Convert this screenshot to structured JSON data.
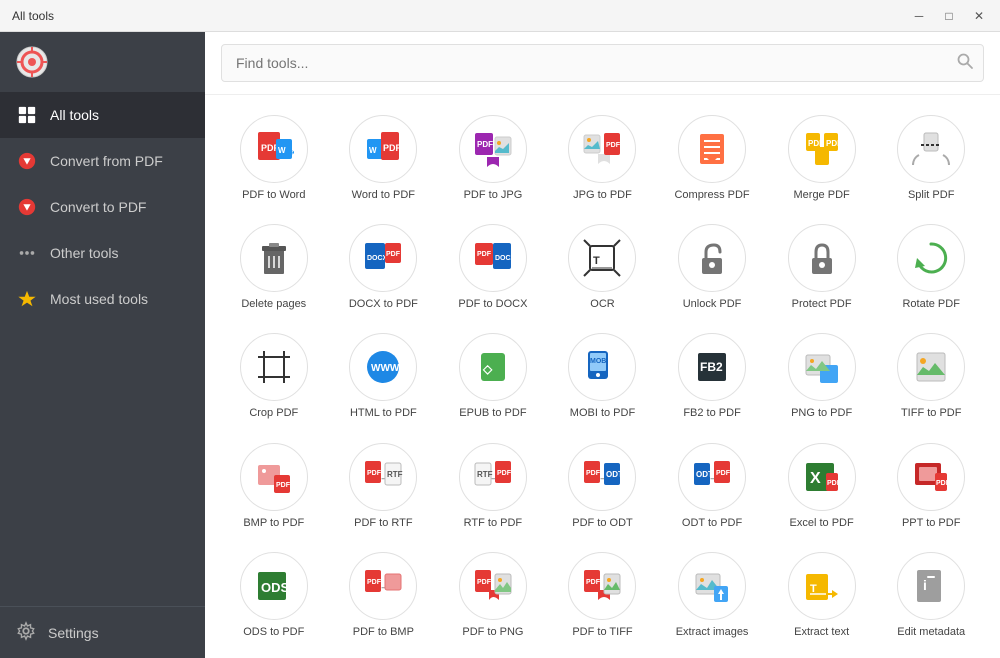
{
  "titleBar": {
    "title": "All tools",
    "minimize": "─",
    "maximize": "□",
    "close": "✕"
  },
  "sidebar": {
    "items": [
      {
        "id": "all-tools",
        "label": "All tools",
        "active": true
      },
      {
        "id": "convert-from-pdf",
        "label": "Convert from PDF",
        "active": false
      },
      {
        "id": "convert-to-pdf",
        "label": "Convert to PDF",
        "active": false
      },
      {
        "id": "other-tools",
        "label": "Other tools",
        "active": false
      },
      {
        "id": "most-used-tools",
        "label": "Most used tools",
        "active": false
      }
    ],
    "settings": "Settings"
  },
  "search": {
    "placeholder": "Find tools..."
  },
  "tools": [
    {
      "id": "pdf-to-word",
      "label": "PDF to Word",
      "icon": "pdf-to-word"
    },
    {
      "id": "word-to-pdf",
      "label": "Word to PDF",
      "icon": "word-to-pdf"
    },
    {
      "id": "pdf-to-jpg",
      "label": "PDF to JPG",
      "icon": "pdf-to-jpg"
    },
    {
      "id": "jpg-to-pdf",
      "label": "JPG to PDF",
      "icon": "jpg-to-pdf"
    },
    {
      "id": "compress-pdf",
      "label": "Compress PDF",
      "icon": "compress-pdf"
    },
    {
      "id": "merge-pdf",
      "label": "Merge PDF",
      "icon": "merge-pdf"
    },
    {
      "id": "split-pdf",
      "label": "Split PDF",
      "icon": "split-pdf"
    },
    {
      "id": "delete-pages",
      "label": "Delete pages",
      "icon": "delete-pages"
    },
    {
      "id": "docx-to-pdf",
      "label": "DOCX to PDF",
      "icon": "docx-to-pdf"
    },
    {
      "id": "pdf-to-docx",
      "label": "PDF to DOCX",
      "icon": "pdf-to-docx"
    },
    {
      "id": "ocr",
      "label": "OCR",
      "icon": "ocr"
    },
    {
      "id": "unlock-pdf",
      "label": "Unlock PDF",
      "icon": "unlock-pdf"
    },
    {
      "id": "protect-pdf",
      "label": "Protect PDF",
      "icon": "protect-pdf"
    },
    {
      "id": "rotate-pdf",
      "label": "Rotate PDF",
      "icon": "rotate-pdf"
    },
    {
      "id": "crop-pdf",
      "label": "Crop PDF",
      "icon": "crop-pdf"
    },
    {
      "id": "html-to-pdf",
      "label": "HTML to PDF",
      "icon": "html-to-pdf"
    },
    {
      "id": "epub-to-pdf",
      "label": "EPUB to PDF",
      "icon": "epub-to-pdf"
    },
    {
      "id": "mobi-to-pdf",
      "label": "MOBI to PDF",
      "icon": "mobi-to-pdf"
    },
    {
      "id": "fb2-to-pdf",
      "label": "FB2 to PDF",
      "icon": "fb2-to-pdf"
    },
    {
      "id": "png-to-pdf",
      "label": "PNG to PDF",
      "icon": "png-to-pdf"
    },
    {
      "id": "tiff-to-pdf",
      "label": "TIFF to PDF",
      "icon": "tiff-to-pdf"
    },
    {
      "id": "bmp-to-pdf",
      "label": "BMP to PDF",
      "icon": "bmp-to-pdf"
    },
    {
      "id": "pdf-to-rtf",
      "label": "PDF to RTF",
      "icon": "pdf-to-rtf"
    },
    {
      "id": "rtf-to-pdf",
      "label": "RTF to PDF",
      "icon": "rtf-to-pdf"
    },
    {
      "id": "pdf-to-odt",
      "label": "PDF to ODT",
      "icon": "pdf-to-odt"
    },
    {
      "id": "odt-to-pdf",
      "label": "ODT to PDF",
      "icon": "odt-to-pdf"
    },
    {
      "id": "excel-to-pdf",
      "label": "Excel to PDF",
      "icon": "excel-to-pdf"
    },
    {
      "id": "ppt-to-pdf",
      "label": "PPT to PDF",
      "icon": "ppt-to-pdf"
    },
    {
      "id": "ods-to-pdf",
      "label": "ODS to PDF",
      "icon": "ods-to-pdf"
    },
    {
      "id": "pdf-to-bmp",
      "label": "PDF to BMP",
      "icon": "pdf-to-bmp"
    },
    {
      "id": "pdf-to-png",
      "label": "PDF to PNG",
      "icon": "pdf-to-png"
    },
    {
      "id": "pdf-to-tiff",
      "label": "PDF to TIFF",
      "icon": "pdf-to-tiff"
    },
    {
      "id": "extract-images",
      "label": "Extract images",
      "icon": "extract-images"
    },
    {
      "id": "extract-text",
      "label": "Extract text",
      "icon": "extract-text"
    },
    {
      "id": "edit-metadata",
      "label": "Edit metadata",
      "icon": "edit-metadata"
    }
  ]
}
